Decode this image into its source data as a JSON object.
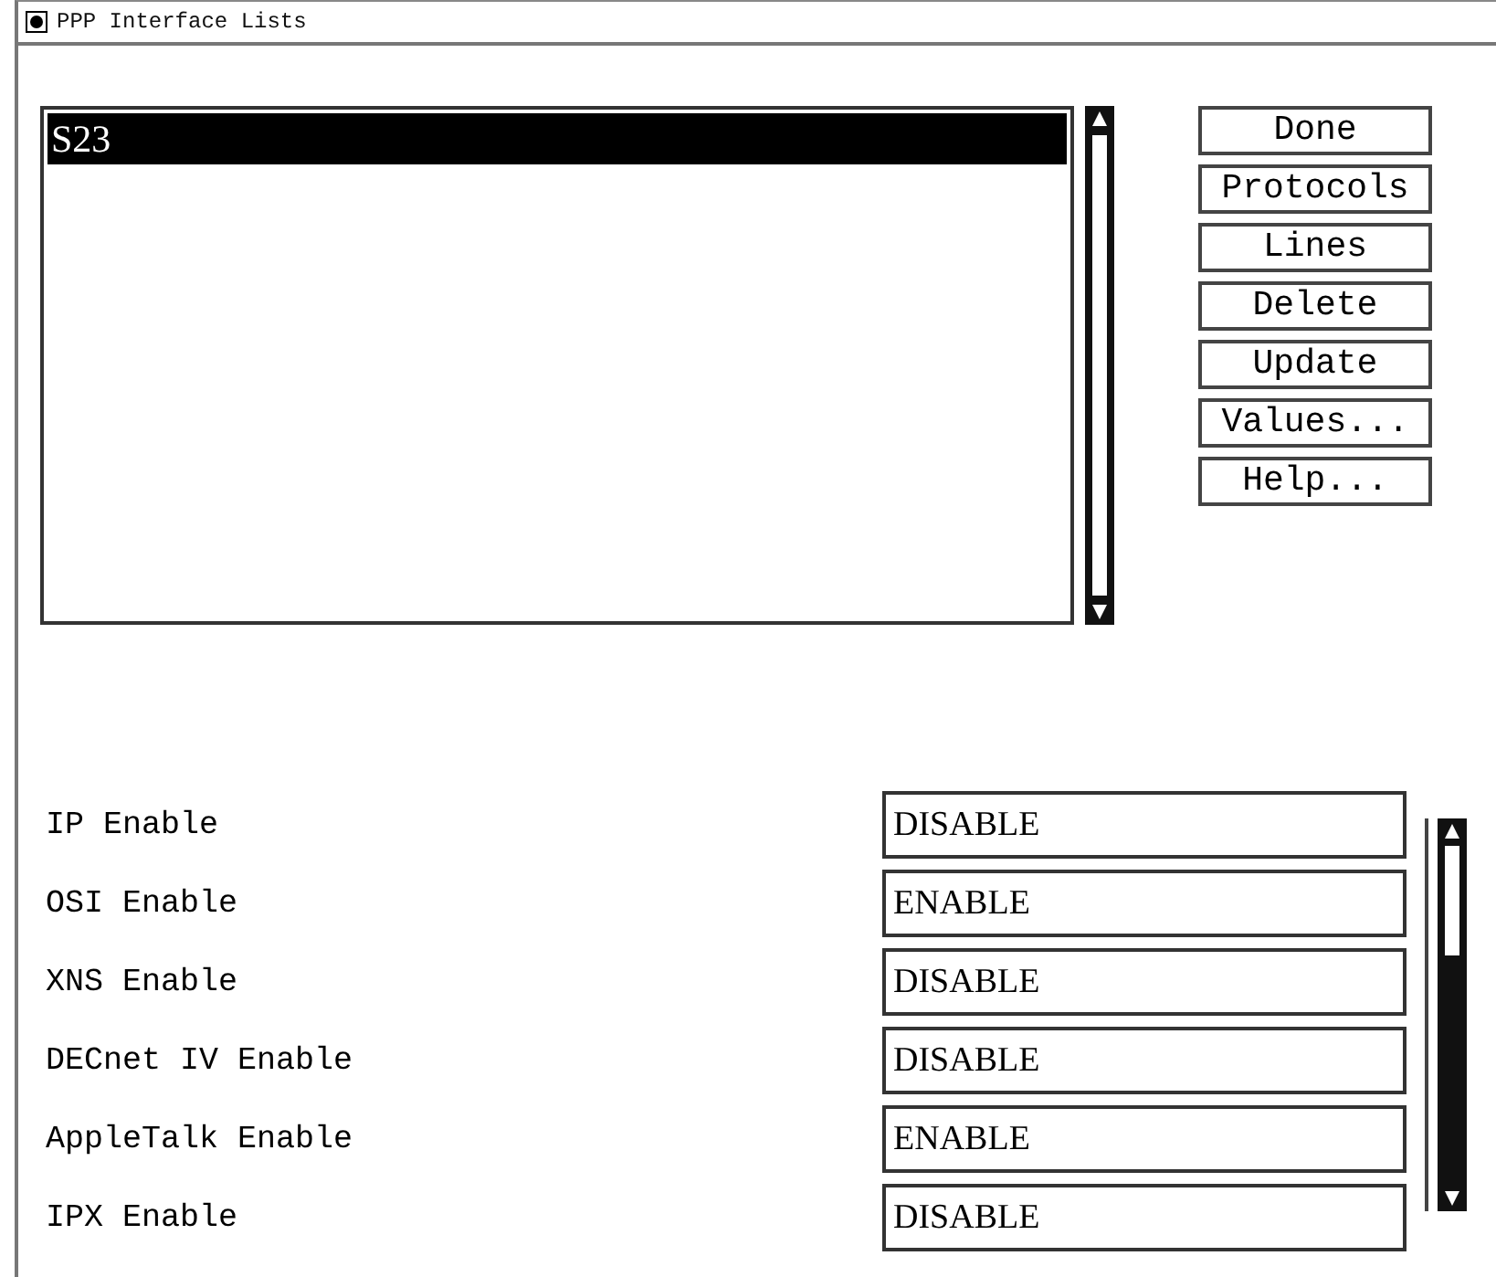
{
  "window": {
    "title": "PPP Interface Lists"
  },
  "interface_list": {
    "items": [
      {
        "label": "S23",
        "selected": true
      }
    ]
  },
  "buttons": [
    "Done",
    "Protocols",
    "Lines",
    "Delete",
    "Update",
    "Values...",
    "Help..."
  ],
  "settings": [
    {
      "label": "IP Enable",
      "value": "DISABLE"
    },
    {
      "label": "OSI Enable",
      "value": "ENABLE"
    },
    {
      "label": "XNS Enable",
      "value": "DISABLE"
    },
    {
      "label": "DECnet IV Enable",
      "value": "DISABLE"
    },
    {
      "label": "AppleTalk Enable",
      "value": "ENABLE"
    },
    {
      "label": "IPX Enable",
      "value": "DISABLE"
    }
  ]
}
